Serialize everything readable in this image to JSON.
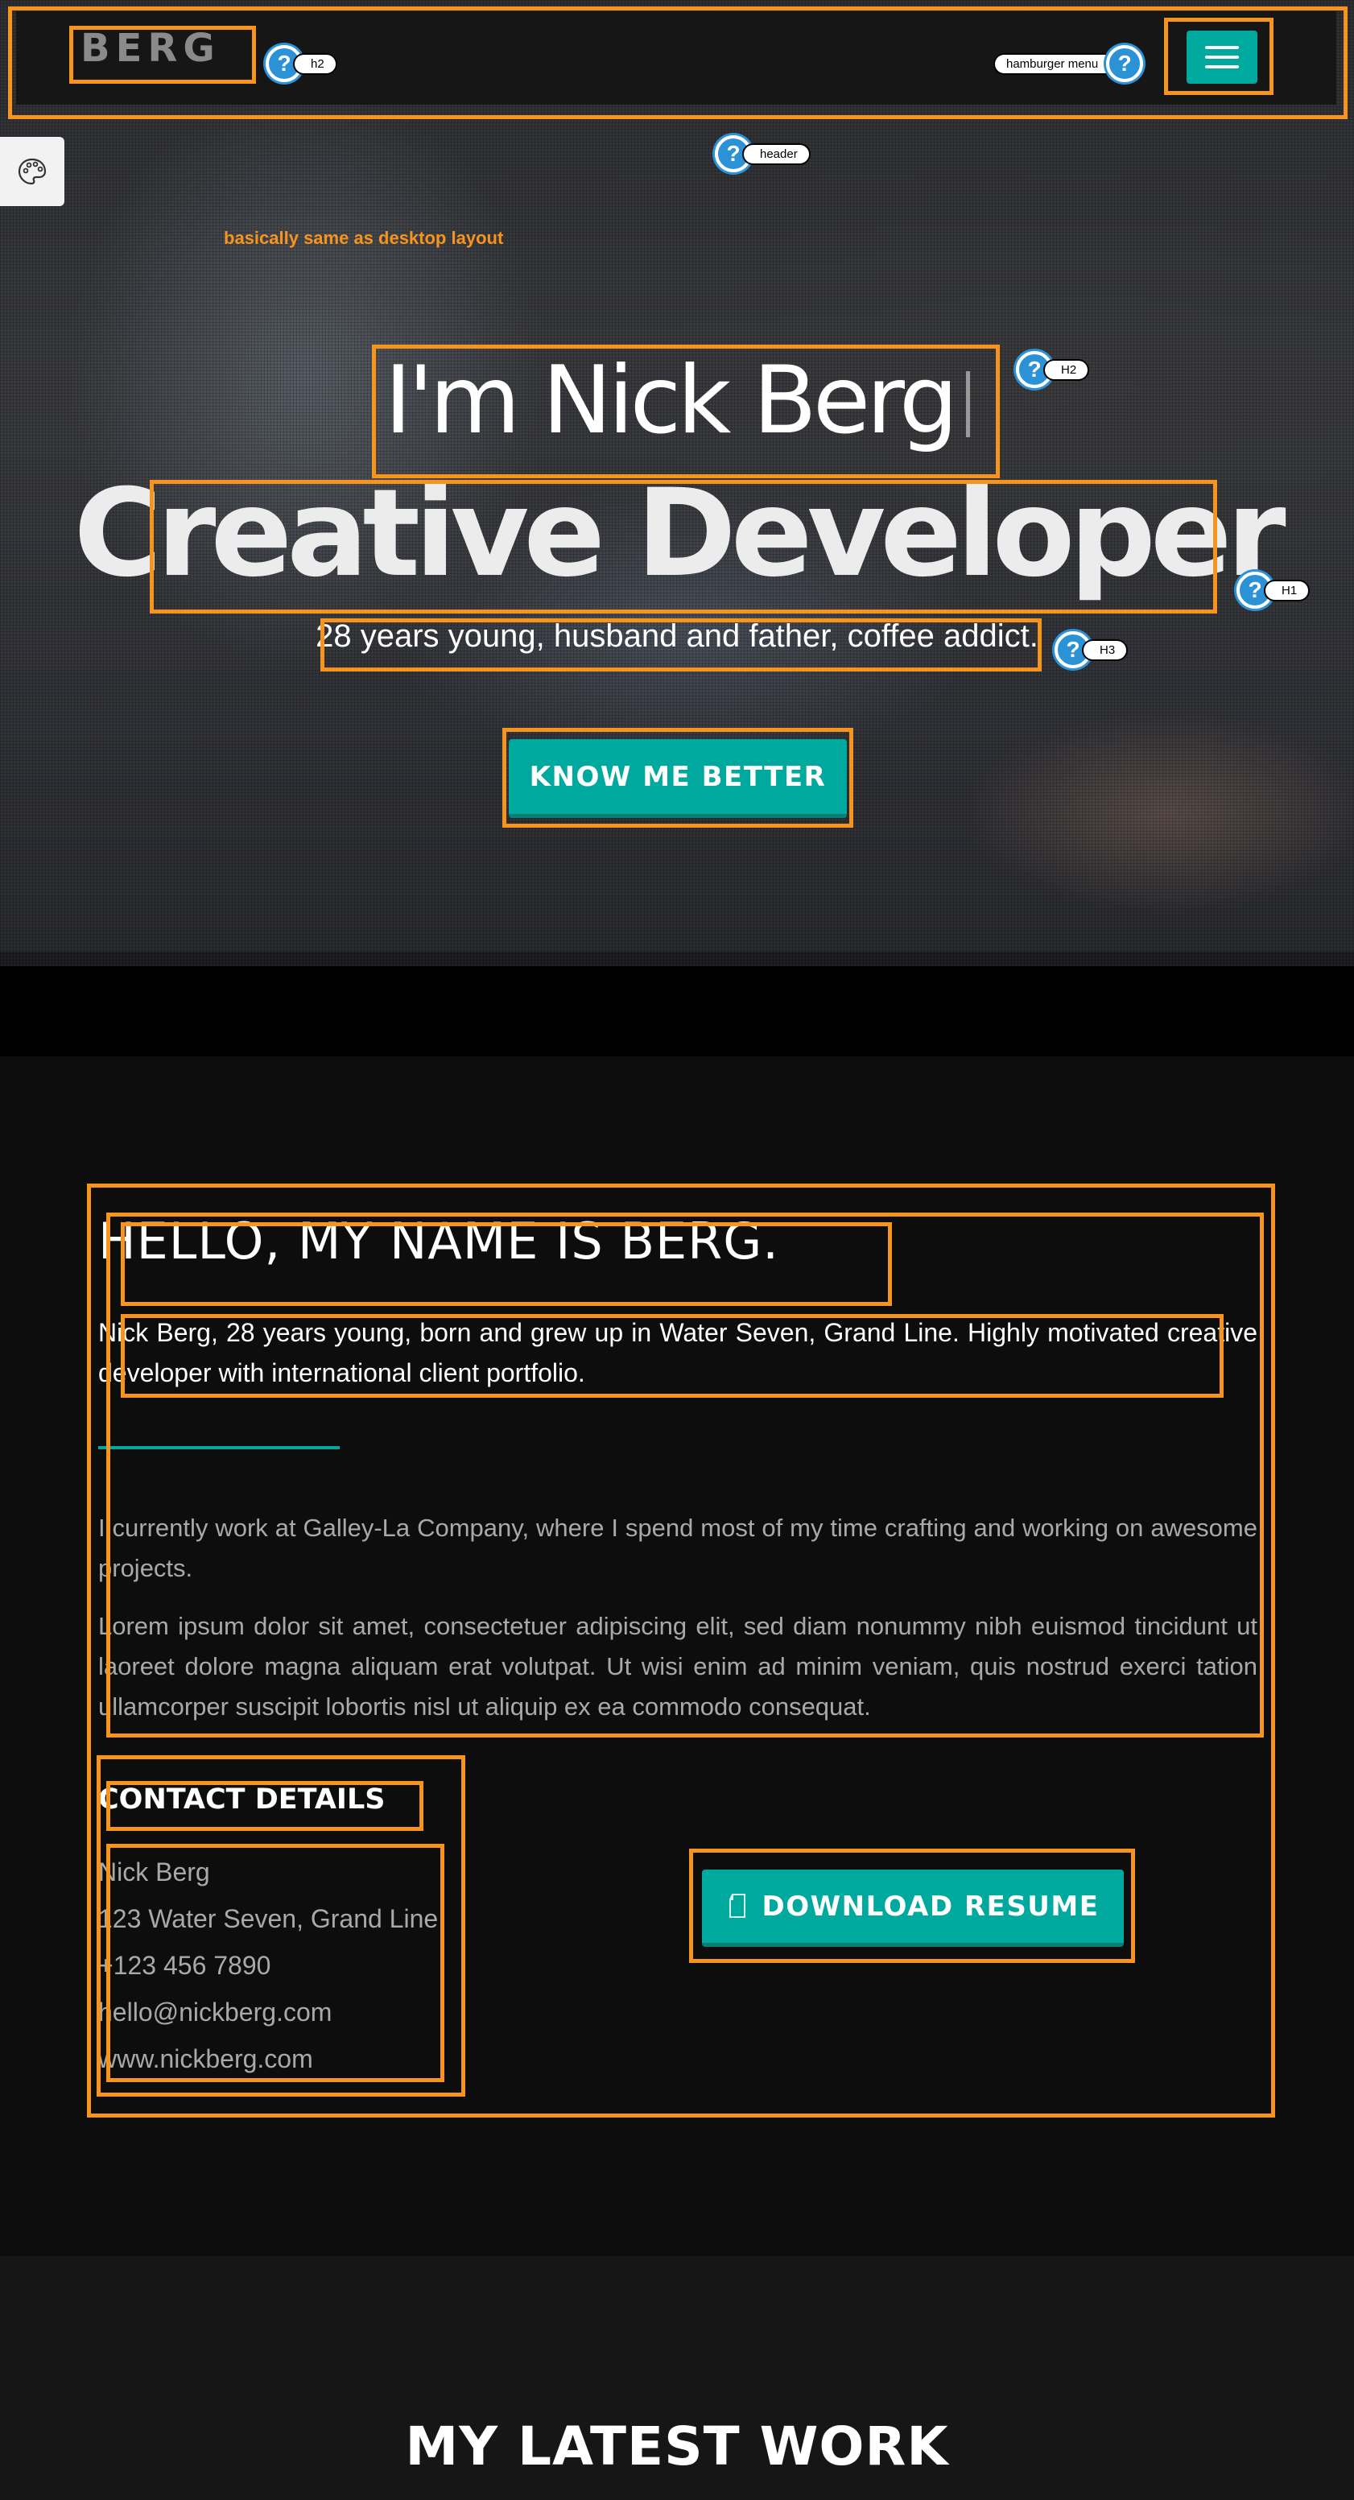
{
  "header": {
    "logo": "BERG",
    "menu_icon": "hamburger-icon"
  },
  "customizer": {
    "icon": "palette-icon"
  },
  "hero": {
    "intro": "I'm Nick Berg",
    "headline": "Creative Developer",
    "tagline": "28 years young, husband and father, coffee addict.",
    "cta_label": "KNOW ME BETTER"
  },
  "about": {
    "heading": "HELLO, MY NAME IS BERG.",
    "lead": "Nick Berg, 28 years young, born and grew up in Water Seven, Grand Line. Highly motivated creative developer with international client portfolio.",
    "paragraphs": [
      "I currently work at Galley-La Company, where I spend most of my time crafting and working on awesome projects.",
      "Lorem ipsum dolor sit amet, consectetuer adipiscing elit, sed diam nonummy nibh euismod tincidunt ut laoreet dolore magna aliquam erat volutpat. Ut wisi enim ad minim veniam, quis nostrud exerci tation ullamcorper suscipit lobortis nisl ut aliquip ex ea commodo consequat."
    ],
    "contact_heading": "CONTACT DETAILS",
    "contact": [
      "Nick Berg",
      "123 Water Seven, Grand Line",
      "+123 456 7890",
      "hello@nickberg.com",
      "www.nickberg.com"
    ],
    "resume_label": "DOWNLOAD RESUME",
    "resume_icon": "document-icon"
  },
  "work": {
    "heading": "MY LATEST WORK"
  },
  "annotations": {
    "logo_tag": "h2",
    "menu_tag": "hamburger menu",
    "header_tag": "header",
    "layout_note": "basically same as desktop layout",
    "intro_tag": "H2",
    "headline_tag": "H1",
    "tagline_tag": "H3",
    "qmark": "?"
  },
  "colors": {
    "accent": "#00a99d",
    "annotation_box": "#f7941d",
    "annotation_marker": "#2b92d6"
  }
}
